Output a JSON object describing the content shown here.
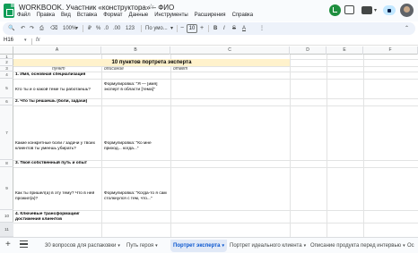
{
  "window": {
    "doc_title": "WORKBOOK. Участник «конструктора» – ФИО",
    "star_icon": "☆",
    "menu": [
      "Файл",
      "Правка",
      "Вид",
      "Вставка",
      "Формат",
      "Данные",
      "Инструменты",
      "Расширения",
      "Справка"
    ]
  },
  "toolbar": {
    "search_icon": "🔍",
    "undo": "↶",
    "redo": "↷",
    "print": "⎙",
    "paint_format": "⌫",
    "zoom": "100%",
    "currency": "₽",
    "percent": "%",
    "decrease_decimals": ".0",
    "increase_decimals": ".00",
    "number_format": "123",
    "font_family": "По умо...",
    "font_size": "10",
    "bold": "B",
    "italic": "I",
    "strike": "S",
    "text_color": "A",
    "more": "⋮",
    "collapse": "⌃"
  },
  "formula_bar": {
    "cell_ref": "H16",
    "fx": "fx"
  },
  "columns": [
    "A",
    "B",
    "C",
    "D",
    "E",
    "F"
  ],
  "rows": [
    "1",
    "2",
    "3",
    "4",
    "5",
    "6",
    "7",
    "8",
    "9",
    "10",
    "11",
    "12",
    "13",
    "14"
  ],
  "sheet": {
    "banner_title": "10 пунктов портрета эксперта",
    "headers": {
      "a": "пункт",
      "b": "описание",
      "c": "ответ"
    },
    "items": [
      {
        "title": "1. Имя, основная специализация",
        "question": "Кто ты и о какой теме ты работаешь?",
        "hint": "Формулировка: \"Я — [имя] эксперт в области [тема]\""
      },
      {
        "title": "2. Что ты решаешь (боли, задачи)",
        "question": "Какие конкретные боли / задачи у твоих клиентов ты умеешь убирать?",
        "hint": "Формулировка: \"Ко мне приход... когда...\""
      },
      {
        "title": "3. Твоя собственный путь и опыт",
        "question": "Как ты пришел(а) в эту тему? Что в ней прожил(а)?",
        "hint": "Формулировка: \"Когда-то я сам столкнулся с тем, что...\""
      },
      {
        "title": "4. Ключевые трансформации/достижения клиентов",
        "question": "",
        "hint": ""
      }
    ]
  },
  "sheet_tabs": {
    "add": "+",
    "tabs": [
      {
        "label": "30 вопросов для распаковки",
        "active": false
      },
      {
        "label": "Путь героя",
        "active": false
      },
      {
        "label": "Портрет эксперта",
        "active": true
      },
      {
        "label": "Портрет идеального клиента",
        "active": false
      },
      {
        "label": "Описание продукта перед интервью",
        "active": false
      },
      {
        "label": "Ос",
        "active": false
      }
    ]
  },
  "colors": {
    "banner_fill": "#fff2cc",
    "active_tab": "#0b57d0",
    "history_icon": "#1e8e3e"
  }
}
